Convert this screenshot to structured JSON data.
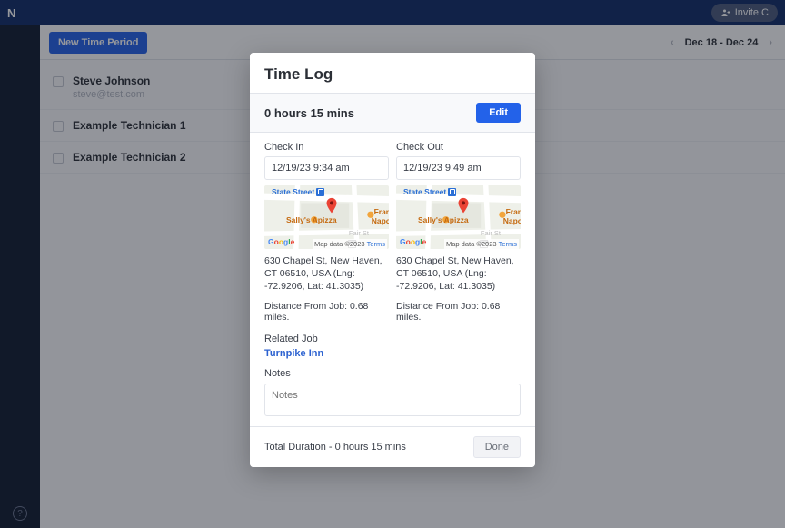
{
  "topbar": {
    "logo_fragment": "N",
    "invite_label": "Invite C"
  },
  "toolbar": {
    "new_time_label": "New Time Period",
    "date_range": "Dec 18 - Dec 24"
  },
  "list": {
    "rows": [
      {
        "name": "Steve Johnson",
        "email": "steve@test.com"
      },
      {
        "name": "Example Technician 1",
        "email": ""
      },
      {
        "name": "Example Technician 2",
        "email": ""
      }
    ]
  },
  "modal": {
    "title": "Time Log",
    "duration_summary": "0 hours 15 mins",
    "edit_label": "Edit",
    "check_in": {
      "label": "Check In",
      "value": "12/19/23 9:34 am",
      "address": "630 Chapel St, New Haven, CT 06510, USA (Lng: -72.9206, Lat: 41.3035)",
      "distance": "Distance From Job: 0.68 miles."
    },
    "check_out": {
      "label": "Check Out",
      "value": "12/19/23 9:49 am",
      "address": "630 Chapel St, New Haven, CT 06510, USA (Lng: -72.9206, Lat: 41.3035)",
      "distance": "Distance From Job: 0.68 miles."
    },
    "map": {
      "state_street_label": "State Street",
      "sally_label": "Sally's Apizza",
      "fran_label": "Fran",
      "napo_label": "Napo",
      "fair_label": "Fair St",
      "attribution": "Map data ©2023",
      "terms": "Terms"
    },
    "related_job_label": "Related Job",
    "related_job_link": "Turnpike Inn",
    "notes_label": "Notes",
    "notes_placeholder": "Notes",
    "footer_total": "Total Duration - 0 hours 15 mins",
    "done_label": "Done"
  }
}
